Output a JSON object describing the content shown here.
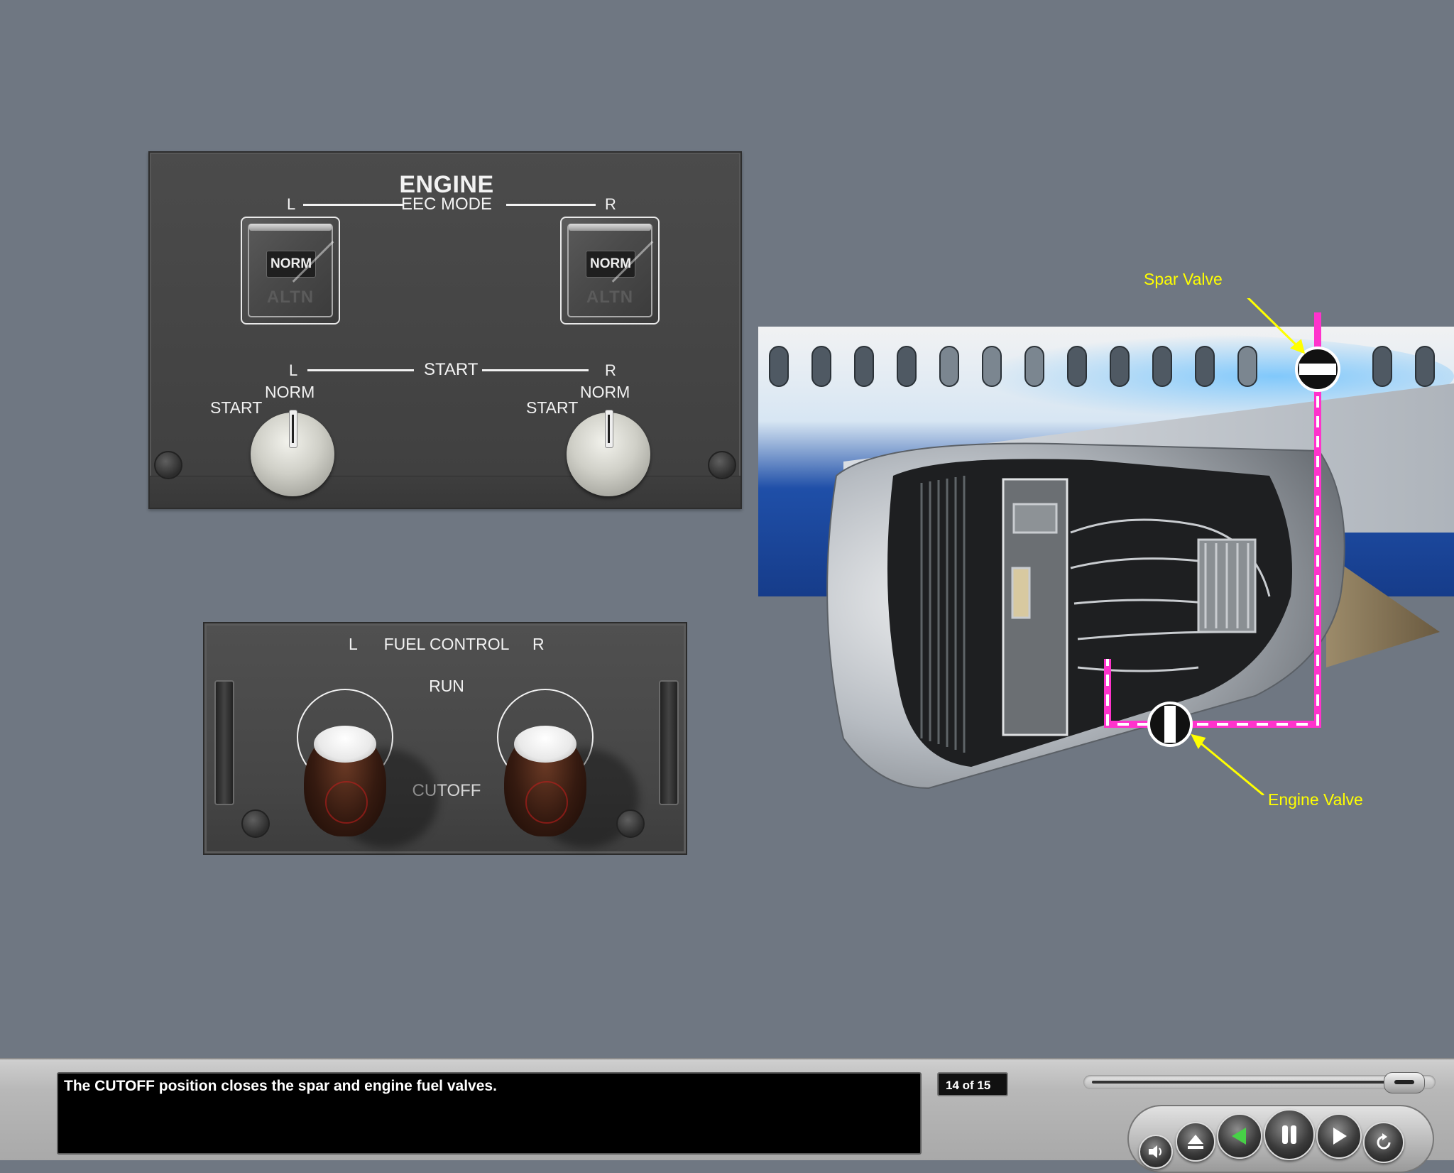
{
  "engine_panel": {
    "title": "ENGINE",
    "eec_mode": {
      "label": "EEC MODE",
      "left_label": "L",
      "right_label": "R",
      "switch_on_label": "NORM",
      "switch_alt_label": "ALTN"
    },
    "start": {
      "label": "START",
      "left_label": "L",
      "right_label": "R",
      "position_start": "START",
      "position_norm": "NORM"
    }
  },
  "fuel_control_panel": {
    "title_left": "L",
    "title": "FUEL CONTROL",
    "title_right": "R",
    "run_label": "RUN",
    "cutoff_label": "CUTOFF"
  },
  "illustration": {
    "spar_valve_label": "Spar Valve",
    "engine_valve_label": "Engine Valve",
    "fuel_line_color": "#ff33cc",
    "callout_color": "#ffff00"
  },
  "player": {
    "caption": "The CUTOFF position closes the spar and engine fuel valves.",
    "page_counter": "14 of 15",
    "progress_fraction": 0.93,
    "buttons": [
      {
        "name": "volume",
        "icon": "speaker-icon"
      },
      {
        "name": "eject",
        "icon": "eject-icon"
      },
      {
        "name": "back",
        "icon": "back-triangle-icon"
      },
      {
        "name": "pause",
        "icon": "pause-icon"
      },
      {
        "name": "play",
        "icon": "play-icon"
      },
      {
        "name": "replay",
        "icon": "replay-icon"
      }
    ]
  }
}
